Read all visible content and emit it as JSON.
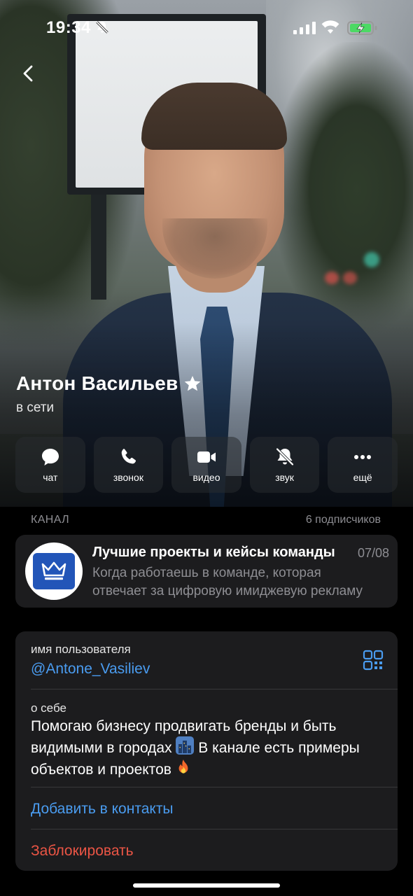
{
  "status_bar": {
    "time": "19:34",
    "icons": [
      "bell-slash-icon",
      "cellular-signal-icon",
      "wifi-icon",
      "battery-charging-icon"
    ],
    "battery_color": "#4cd964"
  },
  "profile": {
    "name": "Антон Васильев",
    "status": "в сети",
    "badge_icon": "star-icon"
  },
  "actions": [
    {
      "label": "чат",
      "icon": "chat-bubble-icon"
    },
    {
      "label": "звонок",
      "icon": "phone-icon"
    },
    {
      "label": "видео",
      "icon": "video-camera-icon"
    },
    {
      "label": "звук",
      "icon": "bell-slash-icon"
    },
    {
      "label": "ещё",
      "icon": "more-dots-icon"
    }
  ],
  "channel_section": {
    "title": "КАНАЛ",
    "subscribers": "6 подписчиков",
    "channel": {
      "name": "Лучшие проекты и кейсы команды",
      "date": "07/08",
      "preview_line1": "Когда работаешь в команде, которая",
      "preview_line2": "отвечает за цифровую имиджевую рекламу",
      "avatar_icon": "crown-logo-icon"
    }
  },
  "info": {
    "username_label": "имя пользователя",
    "username": "@Antone_Vasiliev",
    "about_label": "о себе",
    "about_part1": "Помогаю бизнесу продвигать бренды и быть видимыми в городах",
    "about_part2": "В канале есть примеры объектов и проектов",
    "add_contact": "Добавить в контакты",
    "block": "Заблокировать"
  },
  "colors": {
    "accent_link": "#4a9cf0",
    "danger": "#eb5545",
    "card_bg": "#1c1c1e",
    "secondary_text": "#8e8e93"
  }
}
